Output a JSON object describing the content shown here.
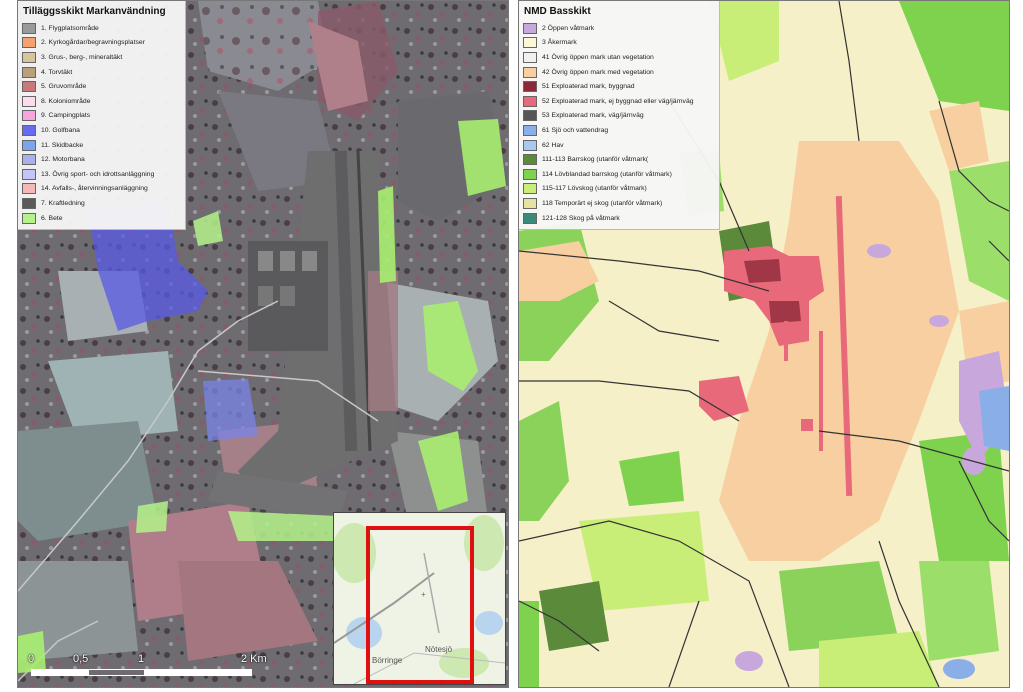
{
  "left_map": {
    "legend": {
      "title": "Tilläggsskikt Markanvändning",
      "items": [
        {
          "label": "1. Flygplatsområde",
          "color": "#9a9a9a"
        },
        {
          "label": "2. Kyrkogårdar/begravningsplatser",
          "color": "#f4a070"
        },
        {
          "label": "3. Grus-, berg-, mineraltäkt",
          "color": "#d8c49a"
        },
        {
          "label": "4. Torvtäkt",
          "color": "#b8a07a"
        },
        {
          "label": "5. Gruvområde",
          "color": "#c8797a"
        },
        {
          "label": "8. Koloniområde",
          "color": "#fbdcec"
        },
        {
          "label": "9. Campingplats",
          "color": "#f6a6dc"
        },
        {
          "label": "10. Golfbana",
          "color": "#6a6aef"
        },
        {
          "label": "11. Skidbacke",
          "color": "#78a6ee"
        },
        {
          "label": "12. Motorbana",
          "color": "#aab0e8"
        },
        {
          "label": "13. Övrig sport- och idrottsanläggning",
          "color": "#c4c4f6"
        },
        {
          "label": "14. Avfalls-, återvinningsanläggning",
          "color": "#f4b8b8"
        },
        {
          "label": "7. Kraftledning",
          "color": "#5a5a5a"
        },
        {
          "label": "6. Bete",
          "color": "#b4f28a"
        }
      ]
    },
    "scalebar": {
      "labels": [
        "0",
        "0,5",
        "1",
        "2 Km"
      ]
    },
    "inset": {
      "place_labels": {
        "borringe": "Börringe",
        "notesjo": "Nötesjö"
      },
      "frame_color": "#e01010"
    }
  },
  "right_map": {
    "legend": {
      "title": "NMD Basskikt",
      "items": [
        {
          "label": "2 Öppen våtmark",
          "color": "#c8a8dc"
        },
        {
          "label": "3 Åkermark",
          "color": "#fbf8d8"
        },
        {
          "label": "41 Övrig öppen mark utan vegetation",
          "color": "#f0f0f0"
        },
        {
          "label": "42 Övrig öppen mark med vegetation",
          "color": "#f7cfa0"
        },
        {
          "label": "51 Exploaterad mark, byggnad",
          "color": "#8c2a3a"
        },
        {
          "label": "52 Exploaterad mark, ej byggnad eller väg/järnväg",
          "color": "#e8697a"
        },
        {
          "label": "53 Exploaterad mark, väg/järnväg",
          "color": "#555555"
        },
        {
          "label": "61 Sjö och vattendrag",
          "color": "#8aaee8"
        },
        {
          "label": "62 Hav",
          "color": "#a8c8f2"
        },
        {
          "label": "111-113 Barrskog (utanför våtmark(",
          "color": "#5a8a3a"
        },
        {
          "label": "114 Lövblandad barrskog (utanför våtmark)",
          "color": "#7ed24e"
        },
        {
          "label": "115-117 Lövskog (utanför våtmark)",
          "color": "#c8ee78"
        },
        {
          "label": "118 Temporärt ej skog (utanför våtmark)",
          "color": "#e8e2a0"
        },
        {
          "label": "121-128 Skog på våtmark",
          "color": "#3a8a7a"
        }
      ]
    }
  }
}
